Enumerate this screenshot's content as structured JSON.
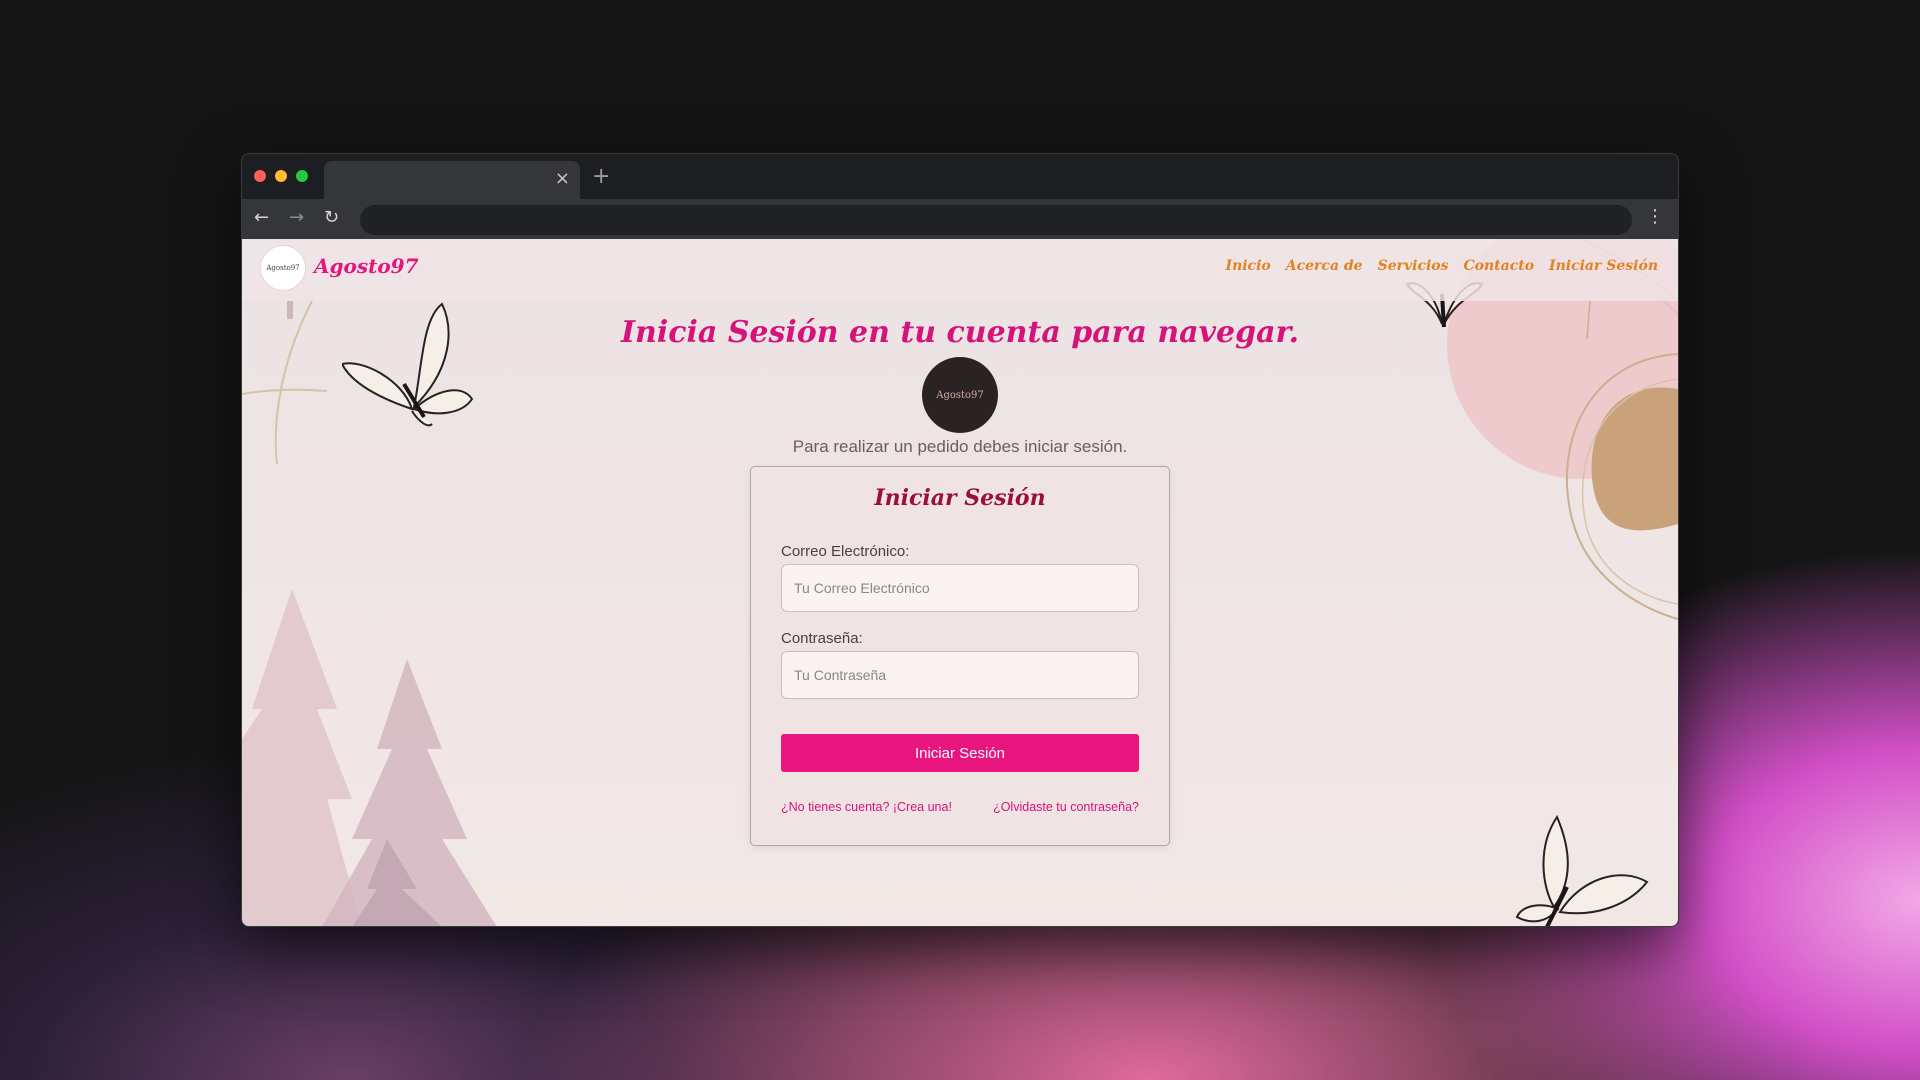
{
  "browser": {
    "tab_close": "×",
    "tab_new": "+",
    "nav": {
      "back": "←",
      "forward": "→",
      "reload": "↻",
      "menu": "⋮"
    }
  },
  "site": {
    "logo_text": "Agosto97",
    "brand": "Agosto97",
    "nav": [
      "Inicio",
      "Acerca de",
      "Servicios",
      "Contacto",
      "Iniciar Sesión"
    ]
  },
  "main": {
    "title": "Inicia Sesión en tu cuenta para navegar.",
    "center_logo_text": "Agosto97",
    "subtitle": "Para realizar un pedido debes iniciar sesión."
  },
  "form": {
    "title": "Iniciar Sesión",
    "email_label": "Correo Electrónico:",
    "email_placeholder": "Tu Correo Electrónico",
    "password_label": "Contraseña:",
    "password_placeholder": "Tu Contraseña",
    "submit_label": "Iniciar Sesión",
    "register_link": "¿No tienes cuenta? ¡Crea una!",
    "forgot_link": "¿Olvidaste tu contraseña?"
  },
  "colors": {
    "accent": "#e8157f",
    "title": "#d4147a",
    "nav_link": "#e3821e",
    "card_title": "#9a0f3f"
  }
}
